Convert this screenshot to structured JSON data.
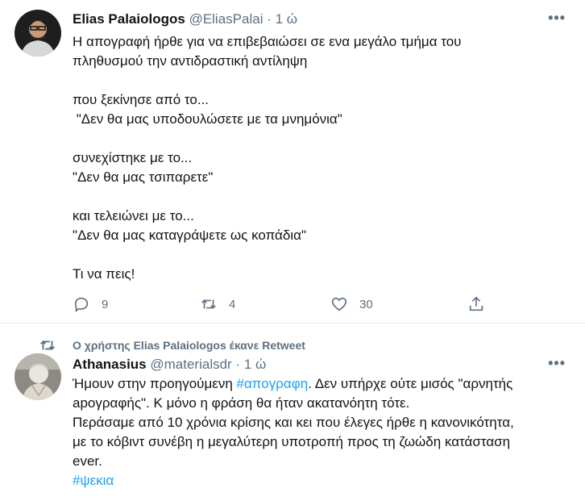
{
  "tweets": [
    {
      "author_name": "Elias Palaiologos",
      "handle": "@EliasPalai",
      "separator": "·",
      "time": "1 ώ",
      "text": "Η απογραφή ήρθε για να επιβεβαιώσει σε ενα μεγάλο τμήμα του\nπληθυσμού την αντιδραστική αντίληψη\n\nπου ξεκίνησε από το...\n \"Δεν θα μας υποδουλώσετε με τα μνημόνια\"\n\nσυνεχίστηκε με το...\n\"Δεν θα μας τσιπαρετε\"\n\nκαι τελειώνει με το...\n\"Δεν θα μας καταγράψετε ως κοπάδια\"\n\nΤι να πεις!",
      "more": "•••",
      "counts": {
        "replies": "9",
        "retweets": "4",
        "likes": "30"
      }
    },
    {
      "retweet_notice": "Ο χρήστης Elias Palaiologos έκανε Retweet",
      "author_name": "Athanasius",
      "handle": "@materialsdr",
      "separator": "·",
      "time": "1 ώ",
      "more": "•••",
      "text_part1": "Ήμουν στην προηγούμενη ",
      "hashtag1": "#απογραφη",
      "text_part2": ". Δεν υπήρχε ούτε μισός \"αρνητής\napογραφής\". Κ μόνο η φράση θα ήταν ακατανόητη τότε.\nΠεράσαμε από 10 χρόνια κρίσης και κει που έλεγες ήρθε η κανονικότητα,\nμε το κόβιντ συνέβη η μεγαλύτερη υποτροπή προς τη ζωώδη κατάσταση\never.\n",
      "hashtag2": "#ψεκια"
    }
  ],
  "colors": {
    "accent": "#1da1f2",
    "muted": "#5b7083",
    "text": "#0f1419"
  },
  "icons": [
    "reply-icon",
    "retweet-icon",
    "like-icon",
    "share-icon"
  ]
}
